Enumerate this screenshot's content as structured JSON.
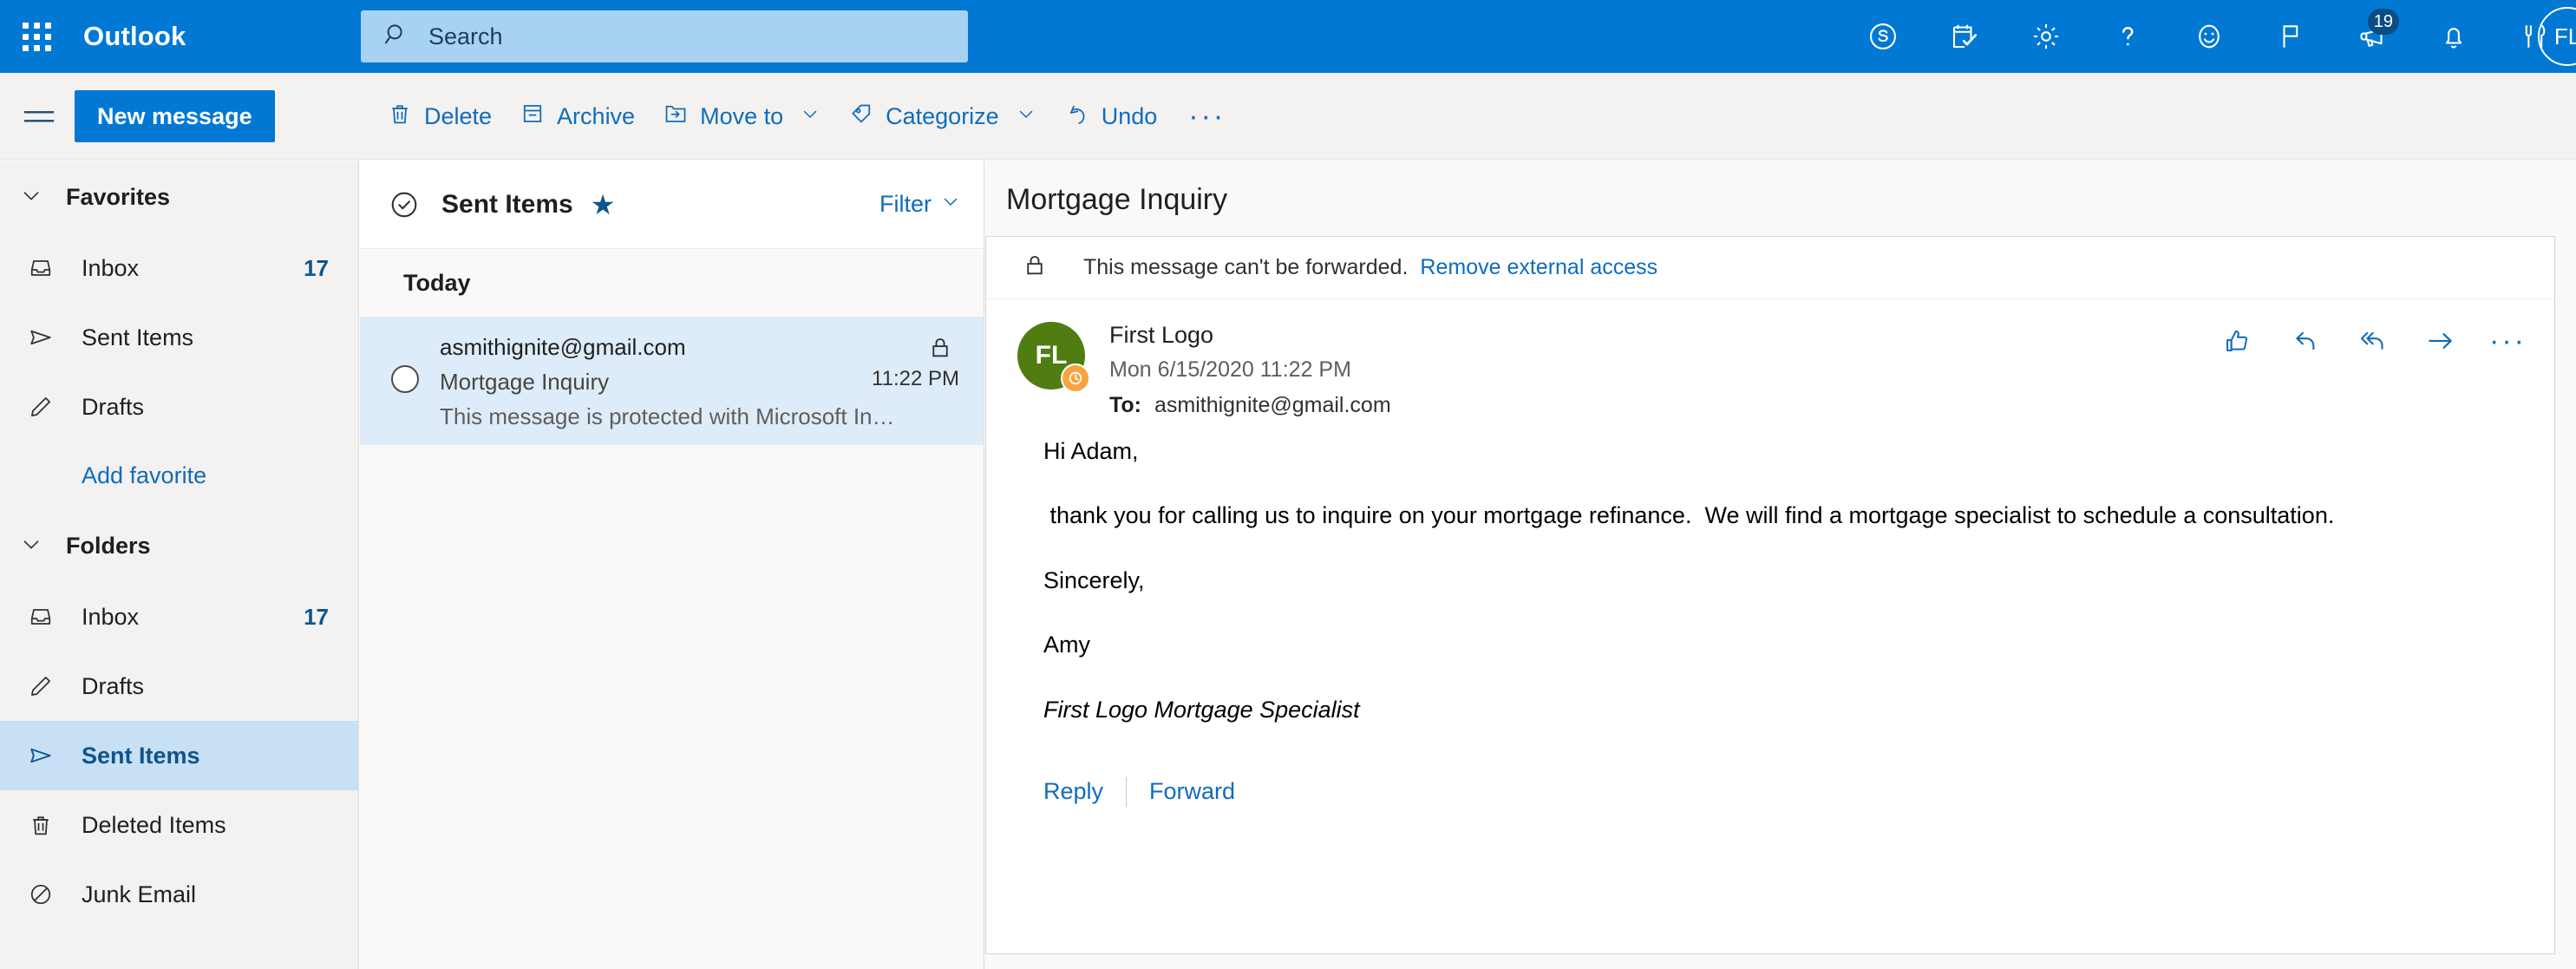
{
  "topbar": {
    "waffle_label": "app-launcher",
    "brand": "Outlook",
    "search": {
      "placeholder": "Search",
      "value": ""
    },
    "icons": [
      {
        "name": "skype-icon",
        "label": "Skype"
      },
      {
        "name": "calendar-task-icon",
        "label": "To Do"
      },
      {
        "name": "gear-icon",
        "label": "Settings"
      },
      {
        "name": "help-icon",
        "label": "Help"
      },
      {
        "name": "smiley-icon",
        "label": "Feedback"
      },
      {
        "name": "flag-icon",
        "label": "Flag"
      },
      {
        "name": "megaphone-icon",
        "label": "What's new",
        "badge": "19"
      },
      {
        "name": "bell-icon",
        "label": "Notifications"
      },
      {
        "name": "utensils-icon",
        "label": "Dining"
      }
    ],
    "avatar": {
      "initials": "FL"
    }
  },
  "commandbar": {
    "hamburger_label": "Toggle navigation",
    "new_message": "New message",
    "actions": [
      {
        "name": "delete-button",
        "label": "Delete",
        "icon": "trash-icon",
        "chevron": false
      },
      {
        "name": "archive-button",
        "label": "Archive",
        "icon": "archive-icon",
        "chevron": false
      },
      {
        "name": "move-to-button",
        "label": "Move to",
        "icon": "move-to-icon",
        "chevron": true
      },
      {
        "name": "categorize-button",
        "label": "Categorize",
        "icon": "tag-icon",
        "chevron": true
      },
      {
        "name": "undo-button",
        "label": "Undo",
        "icon": "undo-icon",
        "chevron": false
      }
    ],
    "overflow": "···"
  },
  "sidebar": {
    "favorites": {
      "label": "Favorites",
      "items": [
        {
          "label": "Inbox",
          "count": "17",
          "icon": "inbox-icon"
        },
        {
          "label": "Sent Items",
          "count": "",
          "icon": "send-icon"
        },
        {
          "label": "Drafts",
          "count": "",
          "icon": "pencil-icon"
        }
      ],
      "add_link": "Add favorite"
    },
    "folders": {
      "label": "Folders",
      "items": [
        {
          "label": "Inbox",
          "count": "17",
          "icon": "inbox-icon",
          "selected": false
        },
        {
          "label": "Drafts",
          "count": "",
          "icon": "pencil-icon",
          "selected": false
        },
        {
          "label": "Sent Items",
          "count": "",
          "icon": "send-icon",
          "selected": true
        },
        {
          "label": "Deleted Items",
          "count": "",
          "icon": "trash-icon",
          "selected": false
        },
        {
          "label": "Junk Email",
          "count": "",
          "icon": "block-icon",
          "selected": false
        }
      ]
    }
  },
  "messagelist": {
    "title": "Sent Items",
    "pinned": true,
    "filter_label": "Filter",
    "day_group": "Today",
    "message": {
      "from": "asmithignite@gmail.com",
      "subject": "Mortgage Inquiry",
      "preview": "This message is protected with Microsoft In…",
      "time": "11:22 PM",
      "protected": true
    }
  },
  "reading": {
    "subject": "Mortgage Inquiry",
    "rights_banner": {
      "text": "This message can't be forwarded.",
      "link": "Remove external access"
    },
    "sender": {
      "initials": "FL",
      "name": "First Logo",
      "date": "Mon 6/15/2020 11:22 PM",
      "to_label": "To:",
      "to_value": "asmithignite@gmail.com",
      "avatar_color": "#4f7d11"
    },
    "actions": [
      {
        "name": "like-button",
        "label": "Like",
        "icon": "thumbs-up-icon"
      },
      {
        "name": "reply-button",
        "label": "Reply",
        "icon": "reply-icon"
      },
      {
        "name": "reply-all-button",
        "label": "Reply all",
        "icon": "reply-all-icon"
      },
      {
        "name": "forward-button",
        "label": "Forward",
        "icon": "forward-arrow-icon"
      }
    ],
    "actions_overflow": "···",
    "body": {
      "greeting": "Hi Adam,",
      "paragraph": " thank you for calling us to inquire on your mortgage refinance.  We will find a mortgage specialist to schedule a consultation.",
      "closing": "Sincerely,",
      "name": "Amy",
      "signature": "First Logo Mortgage Specialist"
    },
    "footer": {
      "reply": "Reply",
      "forward": "Forward"
    }
  },
  "colors": {
    "brand_blue": "#0078d4",
    "link_blue": "#0f6cbd",
    "selected_row": "#deecf9",
    "selected_nav": "#c7e0f4",
    "avatar_green": "#4f7d11",
    "badge_orange": "#f7a440"
  }
}
